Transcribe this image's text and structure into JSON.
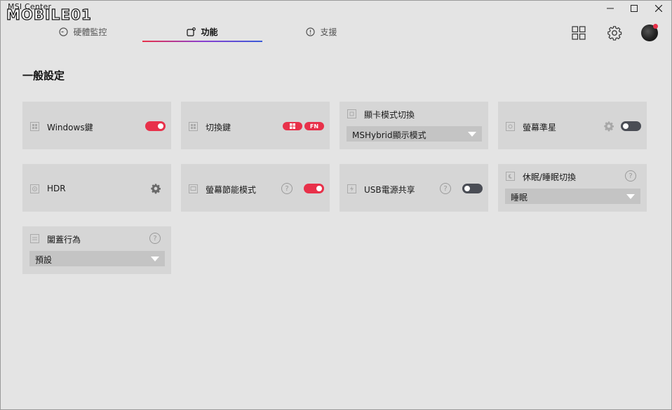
{
  "window": {
    "title": "MSI Center",
    "watermark": "MOBILE01"
  },
  "tabs": [
    {
      "label": "硬體監控"
    },
    {
      "label": "功能"
    },
    {
      "label": "支援"
    }
  ],
  "section": {
    "title": "一般設定"
  },
  "cards": {
    "windows_key": {
      "label": "Windows鍵",
      "toggle": "on"
    },
    "switch_key": {
      "label": "切換鍵",
      "pill_fn": "FN"
    },
    "gpu_mode": {
      "label": "顯卡模式切換",
      "value": "MSHybrid顯示模式"
    },
    "crosshair": {
      "label": "螢幕準星",
      "toggle": "off"
    },
    "hdr": {
      "label": "HDR"
    },
    "screen_power": {
      "label": "螢幕節能模式",
      "toggle": "on",
      "help": "?"
    },
    "usb_share": {
      "label": "USB電源共享",
      "toggle": "off",
      "help": "?"
    },
    "sleep_hibernate": {
      "label": "休眠/睡眠切換",
      "value": "睡眠",
      "help": "?"
    },
    "lid_action": {
      "label": "闔蓋行為",
      "value": "預設",
      "help": "?"
    }
  },
  "colors": {
    "accent": "#e8314a",
    "toggle_off": "#4a4d55",
    "card_bg": "#d6d6d6",
    "page_bg": "#e4e4e4"
  }
}
